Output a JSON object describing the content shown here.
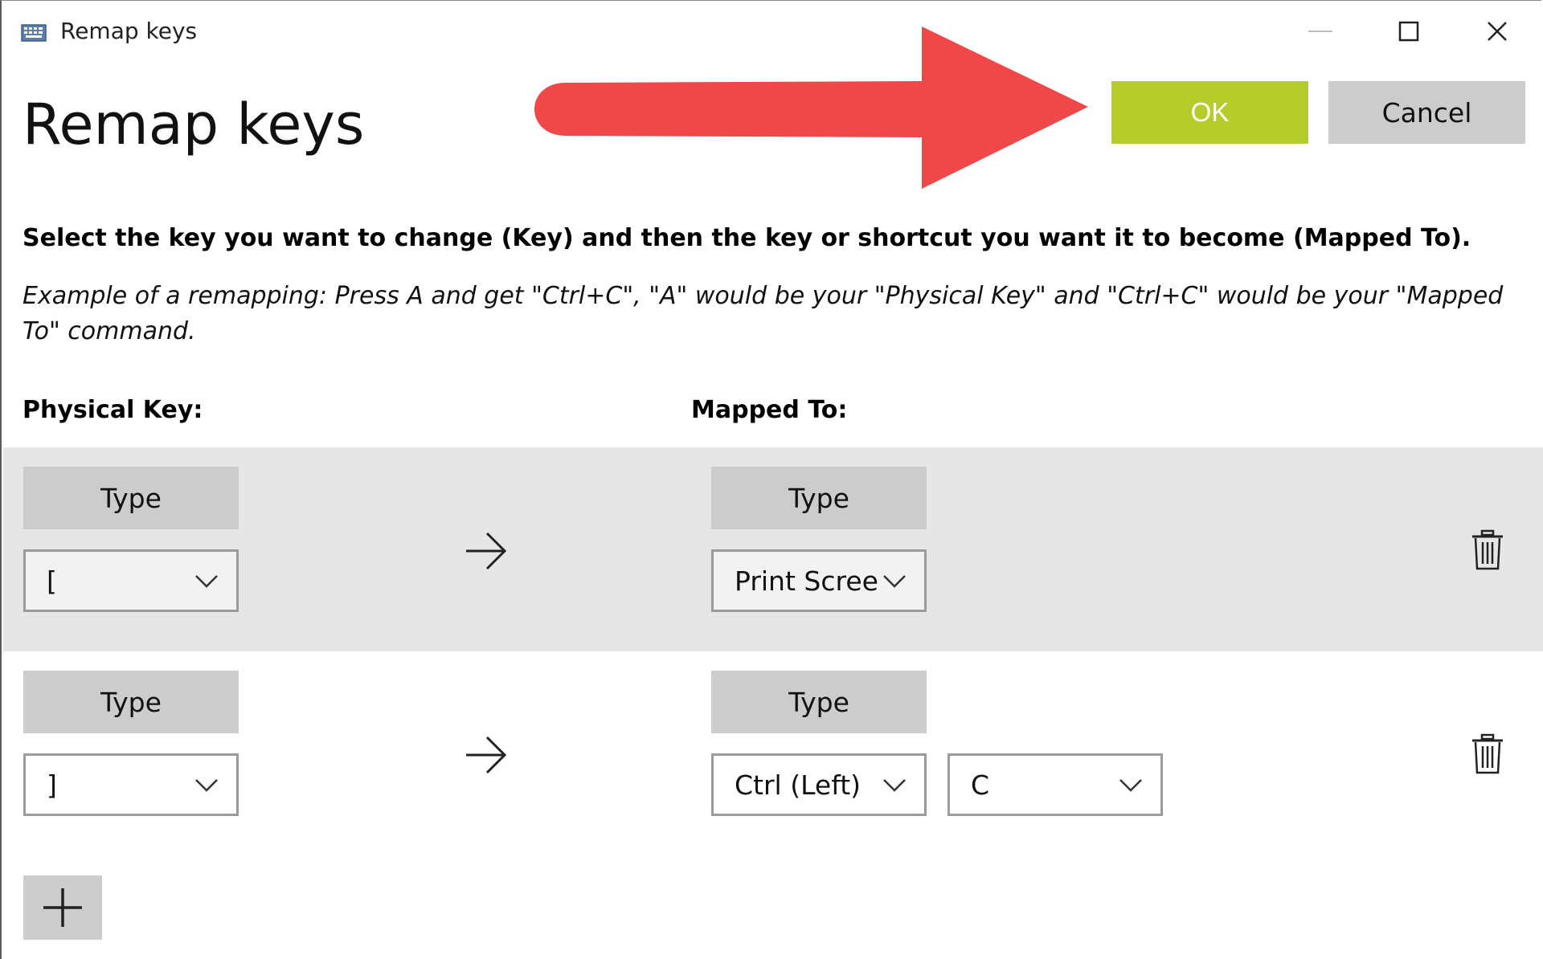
{
  "window": {
    "title": "Remap keys",
    "controls": [
      "minimize-icon",
      "maximize-icon",
      "close-icon"
    ]
  },
  "page": {
    "heading": "Remap keys",
    "instructions": "Select the key you want to change (Key) and then the key or shortcut you want it to become (Mapped To).",
    "example": "Example of a remapping: Press A and get \"Ctrl+C\", \"A\" would be your \"Physical Key\" and \"Ctrl+C\" would be your \"Mapped To\" command."
  },
  "actions": {
    "ok_label": "OK",
    "cancel_label": "Cancel"
  },
  "columns": {
    "physical_key": "Physical Key:",
    "mapped_to": "Mapped To:"
  },
  "rows": [
    {
      "physical": {
        "type_label": "Type",
        "key": "["
      },
      "mapped": {
        "type_label": "Type",
        "keys": [
          "Print Scree"
        ]
      }
    },
    {
      "physical": {
        "type_label": "Type",
        "key": "]"
      },
      "mapped": {
        "type_label": "Type",
        "keys": [
          "Ctrl (Left)",
          "C"
        ]
      }
    }
  ],
  "colors": {
    "ok_button": "#b5cc2b",
    "secondary_button": "#cccccc",
    "annotation_arrow": "#f04848",
    "selected_row": "#e6e6e6"
  },
  "icons": {
    "app": "keyboard-icon",
    "mapping": "right-arrow-icon",
    "delete": "trash-icon",
    "add": "plus-icon",
    "dropdown": "chevron-down-icon"
  }
}
